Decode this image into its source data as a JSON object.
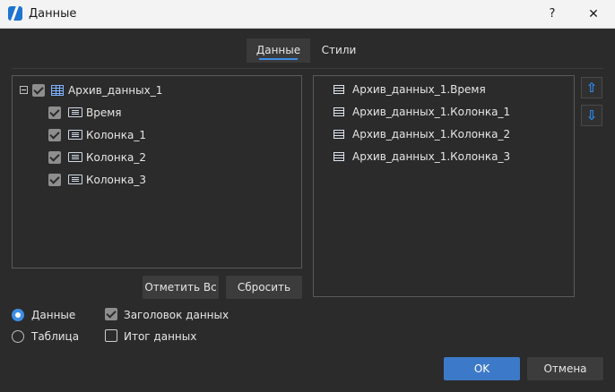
{
  "window": {
    "title": "Данные",
    "help_label": "?",
    "close_label": "✕",
    "icons": {
      "app": "app-logo-icon",
      "help": "help-icon",
      "close": "close-icon"
    }
  },
  "tabs": [
    {
      "label": "Данные",
      "active": true
    },
    {
      "label": "Стили",
      "active": false
    }
  ],
  "tree": {
    "root": {
      "label": "Архив_данных_1",
      "checked": true,
      "expanded": true,
      "icon": "table-icon"
    },
    "children": [
      {
        "label": "Время",
        "checked": true,
        "icon": "column-icon"
      },
      {
        "label": "Колонка_1",
        "checked": true,
        "icon": "column-icon"
      },
      {
        "label": "Колонка_2",
        "checked": true,
        "icon": "column-icon"
      },
      {
        "label": "Колонка_3",
        "checked": true,
        "icon": "column-icon"
      }
    ]
  },
  "selected_list": [
    {
      "label": "Архив_данных_1.Время",
      "icon": "field-icon"
    },
    {
      "label": "Архив_данных_1.Колонка_1",
      "icon": "field-icon"
    },
    {
      "label": "Архив_данных_1.Колонка_2",
      "icon": "field-icon"
    },
    {
      "label": "Архив_данных_1.Колонка_3",
      "icon": "field-icon"
    }
  ],
  "reorder": {
    "up_label": "⇧",
    "down_label": "⇩",
    "icons": {
      "up": "arrow-up-icon",
      "down": "arrow-down-icon"
    }
  },
  "buttons": {
    "select_all": "Отметить Вс",
    "reset": "Сбросить",
    "ok": "OK",
    "cancel": "Отмена"
  },
  "mode": {
    "options": [
      {
        "label": "Данные",
        "selected": true
      },
      {
        "label": "Таблица",
        "selected": false
      }
    ]
  },
  "options": [
    {
      "label": "Заголовок данных",
      "checked": true
    },
    {
      "label": "Итог данных",
      "checked": false
    }
  ],
  "colors": {
    "accent": "#3d8ee6",
    "primary_button": "#3d79c9",
    "background": "#2b2b2b",
    "titlebar": "#f3f3f3"
  }
}
